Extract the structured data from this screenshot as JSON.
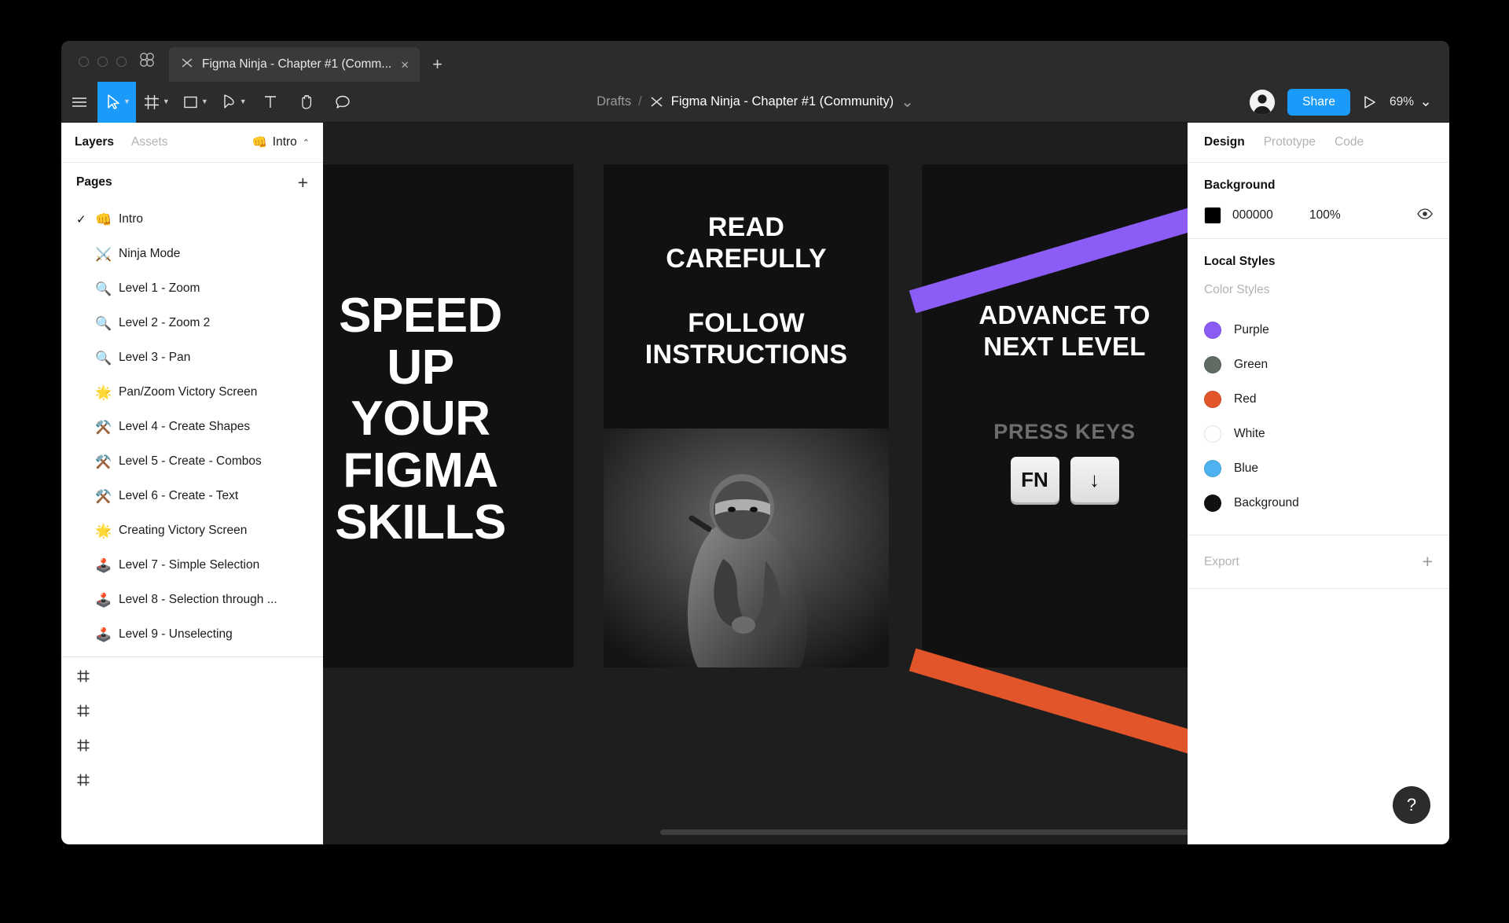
{
  "window": {
    "tab": {
      "title": "Figma Ninja - Chapter #1 (Comm...",
      "icon": "figma-ninja-file-icon",
      "close_label": "×",
      "new_tab_label": "+"
    },
    "app_icon": "figma-logo-icon"
  },
  "toolbar": {
    "menu_icon": "hamburger-menu-icon",
    "tools": [
      {
        "name": "move-tool",
        "icon": "cursor-arrow-icon",
        "has_caret": true,
        "active": true
      },
      {
        "name": "frame-tool",
        "icon": "frame-icon",
        "has_caret": true,
        "active": false
      },
      {
        "name": "shape-tool",
        "icon": "square-icon",
        "has_caret": true,
        "active": false
      },
      {
        "name": "pen-tool",
        "icon": "pen-icon",
        "has_caret": true,
        "active": false
      },
      {
        "name": "text-tool",
        "icon": "text-t-icon",
        "has_caret": false,
        "active": false
      },
      {
        "name": "hand-tool",
        "icon": "hand-icon",
        "has_caret": false,
        "active": false
      },
      {
        "name": "comment-tool",
        "icon": "comment-bubble-icon",
        "has_caret": false,
        "active": false
      }
    ],
    "breadcrumb": {
      "project": "Drafts",
      "separator": "/",
      "file_icon": "figma-ninja-file-icon",
      "file": "Figma Ninja - Chapter #1 (Community)",
      "caret": "⌄"
    },
    "avatar_name": "user-avatar",
    "share_label": "Share",
    "present_icon": "play-triangle-icon",
    "zoom_value": "69%",
    "zoom_caret": "⌄"
  },
  "left_panel": {
    "tabs": [
      {
        "label": "Layers",
        "active": true
      },
      {
        "label": "Assets",
        "active": false
      }
    ],
    "current_page": {
      "emoji": "👊",
      "label": "Intro",
      "caret": "⌃"
    },
    "pages_header": {
      "title": "Pages",
      "add_label": "+"
    },
    "pages": [
      {
        "emoji": "👊",
        "label": "Intro",
        "selected": true
      },
      {
        "emoji": "⚔️",
        "label": "Ninja Mode",
        "selected": false
      },
      {
        "emoji": "🔍",
        "label": "Level 1 - Zoom",
        "selected": false
      },
      {
        "emoji": "🔍",
        "label": "Level 2 - Zoom 2",
        "selected": false
      },
      {
        "emoji": "🔍",
        "label": "Level 3 - Pan",
        "selected": false
      },
      {
        "emoji": "🌟",
        "label": "Pan/Zoom Victory Screen",
        "selected": false
      },
      {
        "emoji": "⚒️",
        "label": "Level 4 - Create Shapes",
        "selected": false
      },
      {
        "emoji": "⚒️",
        "label": "Level 5 - Create - Combos",
        "selected": false
      },
      {
        "emoji": "⚒️",
        "label": "Level 6 - Create - Text",
        "selected": false
      },
      {
        "emoji": "🌟",
        "label": "Creating Victory Screen",
        "selected": false
      },
      {
        "emoji": "🕹️",
        "label": "Level 7 - Simple Selection",
        "selected": false
      },
      {
        "emoji": "🕹️",
        "label": "Level 8 - Selection through ...",
        "selected": false
      },
      {
        "emoji": "🕹️",
        "label": "Level 9 - Unselecting",
        "selected": false
      }
    ],
    "layer_rows": [
      {
        "icon": "frame-hash-icon"
      },
      {
        "icon": "frame-hash-icon"
      },
      {
        "icon": "frame-hash-icon"
      },
      {
        "icon": "frame-hash-icon"
      }
    ]
  },
  "canvas": {
    "artboards": [
      {
        "name": "speed-up-artboard",
        "lines": [
          "SPEED",
          "UP",
          "YOUR",
          "FIGMA",
          "SKILLS"
        ]
      },
      {
        "name": "instructions-artboard",
        "block1": [
          "READ",
          "CAREFULLY"
        ],
        "block2": [
          "FOLLOW",
          "INSTRUCTIONS"
        ],
        "photo_name": "ninja-photo"
      },
      {
        "name": "advance-artboard",
        "title": [
          "ADVANCE TO",
          "NEXT LEVEL"
        ],
        "press_keys_label": "PRESS KEYS",
        "keys": [
          {
            "label": "FN",
            "name": "fn-key"
          },
          {
            "label": "↓",
            "name": "arrow-down-key"
          }
        ],
        "stripe_purple": "#8b5cf6",
        "stripe_red": "#e2552a"
      }
    ]
  },
  "right_panel": {
    "tabs": [
      {
        "label": "Design",
        "active": true
      },
      {
        "label": "Prototype",
        "active": false
      },
      {
        "label": "Code",
        "active": false
      }
    ],
    "background": {
      "title": "Background",
      "hex": "000000",
      "color": "#000000",
      "opacity": "100%",
      "visibility_icon": "eye-icon"
    },
    "local_styles": {
      "title": "Local Styles",
      "subtitle": "Color Styles",
      "colors": [
        {
          "label": "Purple",
          "color": "#8b5cf6"
        },
        {
          "label": "Green",
          "color": "#5f6b63"
        },
        {
          "label": "Red",
          "color": "#e2552a"
        },
        {
          "label": "White",
          "color": "#ffffff"
        },
        {
          "label": "Blue",
          "color": "#4db3f0"
        },
        {
          "label": "Background",
          "color": "#111111"
        }
      ]
    },
    "export": {
      "label": "Export",
      "add_label": "+"
    },
    "help_label": "?"
  }
}
